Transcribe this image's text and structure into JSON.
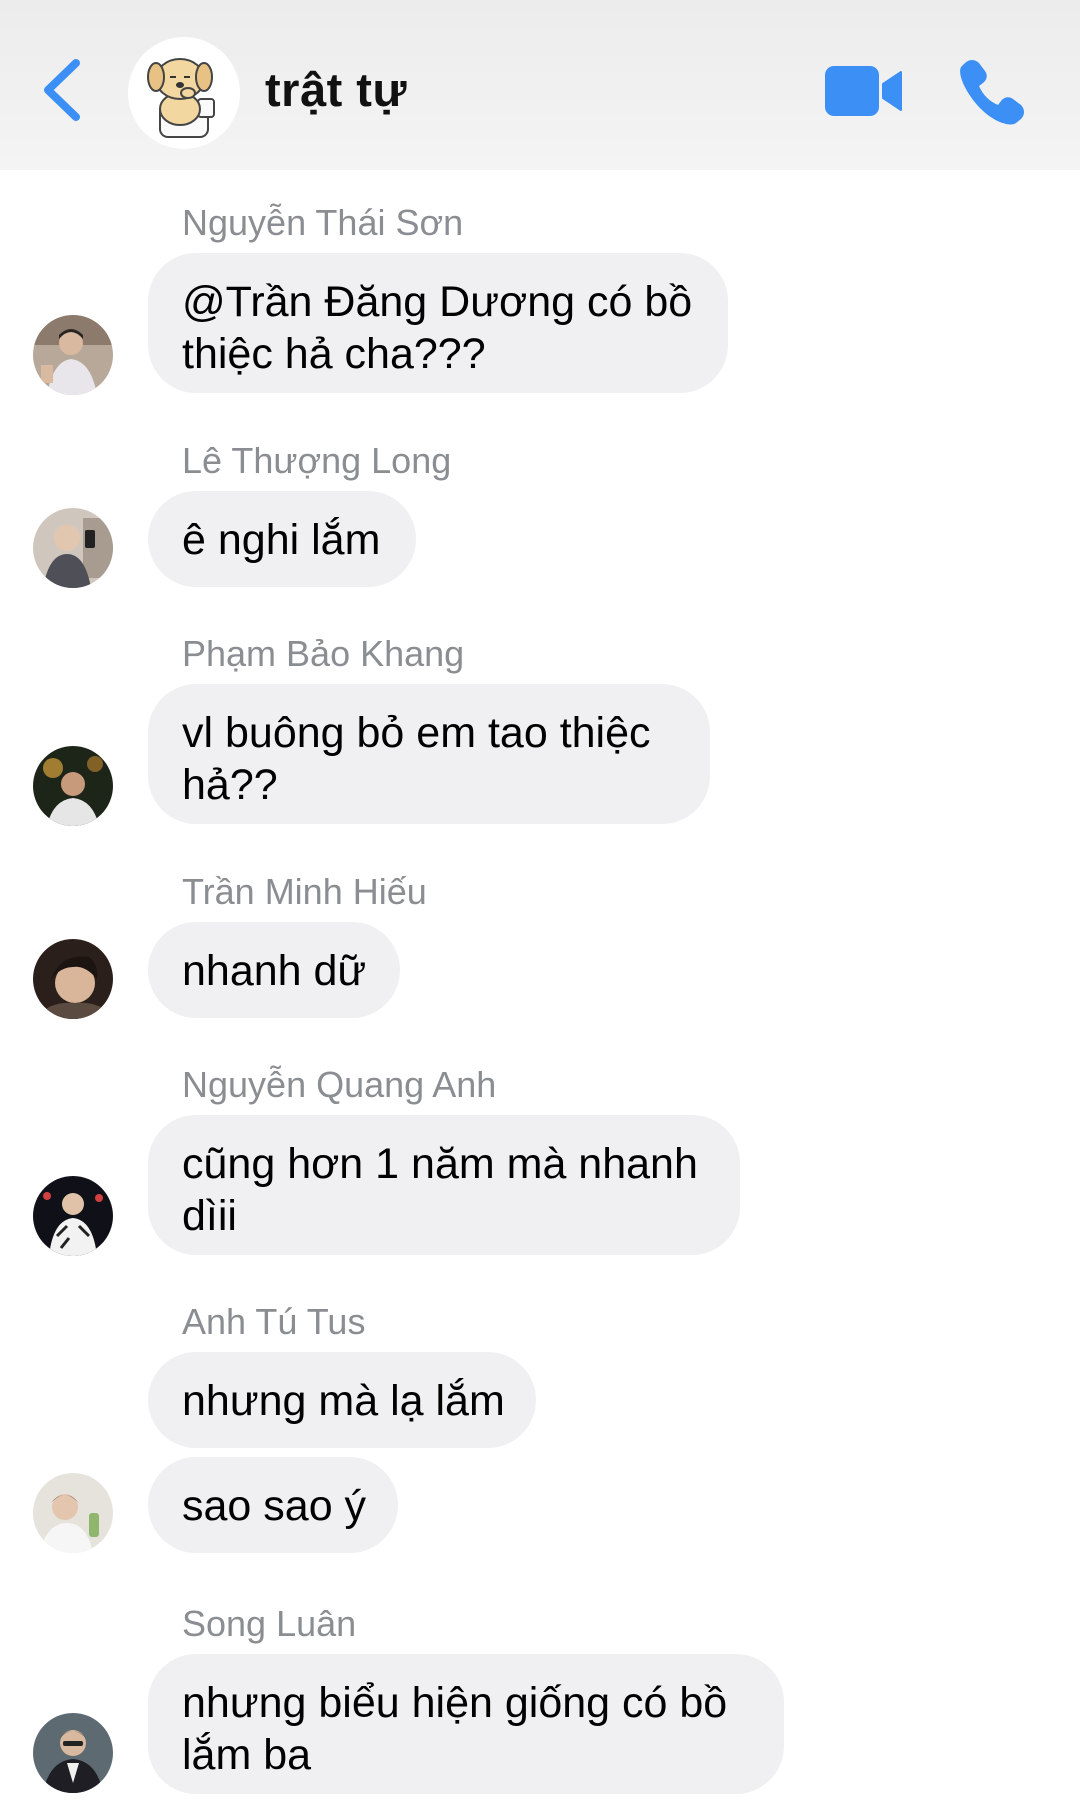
{
  "header": {
    "title": "trật tự",
    "back_icon": "chevron-left-icon",
    "video_icon": "video-camera-icon",
    "call_icon": "phone-icon",
    "accent_color": "#3b8ff5"
  },
  "messages": [
    {
      "sender": "Nguyễn Thái Sơn",
      "lines": [
        "@Trần Đăng Dương có bồ",
        "thiệc hả cha???"
      ]
    },
    {
      "sender": "Lê Thượng Long",
      "lines": [
        "ê nghi lắm"
      ]
    },
    {
      "sender": "Phạm Bảo Khang",
      "lines": [
        "vl buông bỏ em tao thiệc",
        "hả??"
      ]
    },
    {
      "sender": "Trần Minh Hiếu",
      "lines": [
        "nhanh dữ"
      ]
    },
    {
      "sender": "Nguyễn Quang Anh",
      "lines": [
        "cũng hơn 1 năm mà nhanh",
        "dìii"
      ]
    },
    {
      "sender": "Anh Tú Tus",
      "lines": [
        "nhưng mà lạ lắm"
      ]
    },
    {
      "sender": "",
      "lines": [
        "sao sao ý"
      ]
    },
    {
      "sender": "Song Luân",
      "lines": [
        "nhưng biểu hiện giống có bồ",
        "lắm ba"
      ]
    }
  ],
  "colors": {
    "bubble_bg": "#f0f0f2",
    "sender_name": "#8a8d91",
    "header_bg": "#efefef"
  }
}
